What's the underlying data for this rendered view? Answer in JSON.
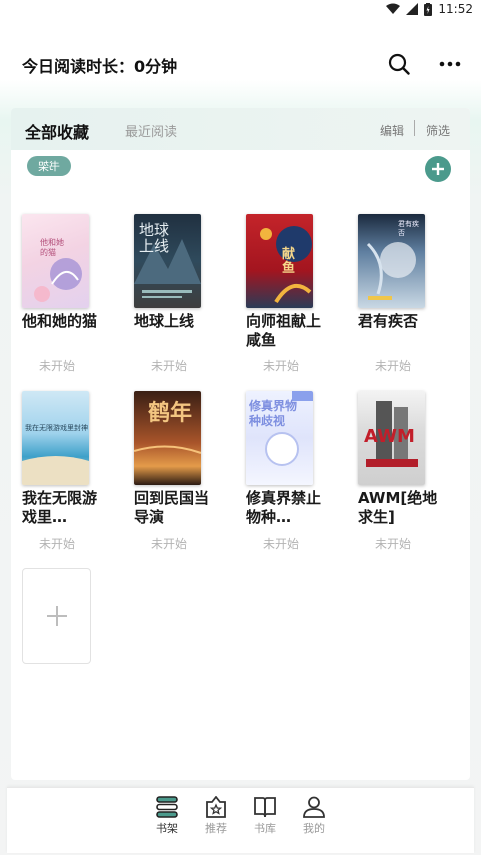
{
  "status_bar": {
    "time": "11:52"
  },
  "header": {
    "reading_time_label": "今日阅读时长：0分钟"
  },
  "tabs": {
    "active": "全部收藏",
    "recent": "最近阅读",
    "edit": "编辑",
    "filter": "筛选"
  },
  "tag_chip": "书架",
  "books": [
    {
      "title": "他和她的猫",
      "status": "未开始",
      "cover_text": "他和她的猫"
    },
    {
      "title": "地球上线",
      "status": "未开始",
      "cover_text": "地球上线"
    },
    {
      "title": "向师祖献上咸鱼",
      "status": "未开始",
      "cover_text": "献鱼"
    },
    {
      "title": "君有疾否",
      "status": "未开始",
      "cover_text": "君有疾否"
    },
    {
      "title": "我在无限游戏里…",
      "status": "未开始",
      "cover_text": "我在无限游戏里封神"
    },
    {
      "title": "回到民国当导演",
      "status": "未开始",
      "cover_text": "鹤年"
    },
    {
      "title": "修真界禁止物种…",
      "status": "未开始",
      "cover_text": "修真界物种歧视"
    },
    {
      "title": "AWM[绝地求生]",
      "status": "未开始",
      "cover_text": "AWM"
    }
  ],
  "nav": [
    {
      "label": "书架",
      "active": true
    },
    {
      "label": "推荐",
      "active": false
    },
    {
      "label": "书库",
      "active": false
    },
    {
      "label": "我的",
      "active": false
    }
  ],
  "colors": {
    "accent": "#4b9a8c",
    "chip": "#6fa9a0",
    "muted": "#b3b3b3"
  }
}
